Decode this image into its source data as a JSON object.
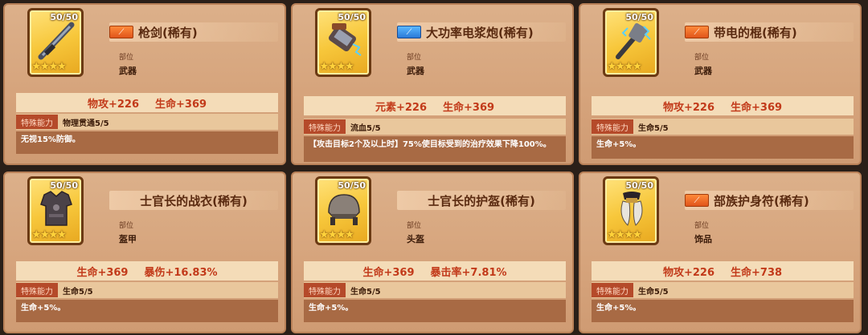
{
  "cards": [
    {
      "count": "50/50",
      "stars": "★★★★",
      "badge_color": "orange",
      "title": "枪剑(稀有)",
      "slot_label": "部位",
      "slot_value": "武器",
      "stats": [
        "物攻+226",
        "生命+369"
      ],
      "ability_tag": "特殊能力",
      "ability_name": "物理贯通5/5",
      "description": "无视15%防御。",
      "icon": "gun-sword-icon"
    },
    {
      "count": "50/50",
      "stars": "★★★★",
      "badge_color": "blue",
      "title": "大功率电浆炮(稀有)",
      "slot_label": "部位",
      "slot_value": "武器",
      "stats": [
        "元素+226",
        "生命+369"
      ],
      "ability_tag": "特殊能力",
      "ability_name": "流血5/5",
      "description": "【攻击目标2个及以上时】75%使目标受到的治疗效果下降100%。",
      "icon": "plasma-cannon-icon"
    },
    {
      "count": "50/50",
      "stars": "★★★★",
      "badge_color": "orange",
      "title": "带电的棍(稀有)",
      "slot_label": "部位",
      "slot_value": "武器",
      "stats": [
        "物攻+226",
        "生命+369"
      ],
      "ability_tag": "特殊能力",
      "ability_name": "生命5/5",
      "description": "生命+5%。",
      "icon": "electric-club-icon"
    },
    {
      "count": "50/50",
      "stars": "★★★★",
      "badge_color": "",
      "title": "士官长的战衣(稀有)",
      "slot_label": "部位",
      "slot_value": "盔甲",
      "stats": [
        "生命+369",
        "暴伤+16.83%"
      ],
      "ability_tag": "特殊能力",
      "ability_name": "生命5/5",
      "description": "生命+5%。",
      "icon": "armor-vest-icon"
    },
    {
      "count": "50/50",
      "stars": "★★★★",
      "badge_color": "",
      "title": "士官长的护盔(稀有)",
      "slot_label": "部位",
      "slot_value": "头盔",
      "stats": [
        "生命+369",
        "暴击率+7.81%"
      ],
      "ability_tag": "特殊能力",
      "ability_name": "生命5/5",
      "description": "生命+5%。",
      "icon": "helmet-icon"
    },
    {
      "count": "50/50",
      "stars": "★★★★",
      "badge_color": "orange",
      "title": "部族护身符(稀有)",
      "slot_label": "部位",
      "slot_value": "饰品",
      "stats": [
        "物攻+226",
        "生命+738"
      ],
      "ability_tag": "特殊能力",
      "ability_name": "生命5/5",
      "description": "生命+5%。",
      "icon": "tribal-amulet-icon"
    }
  ]
}
